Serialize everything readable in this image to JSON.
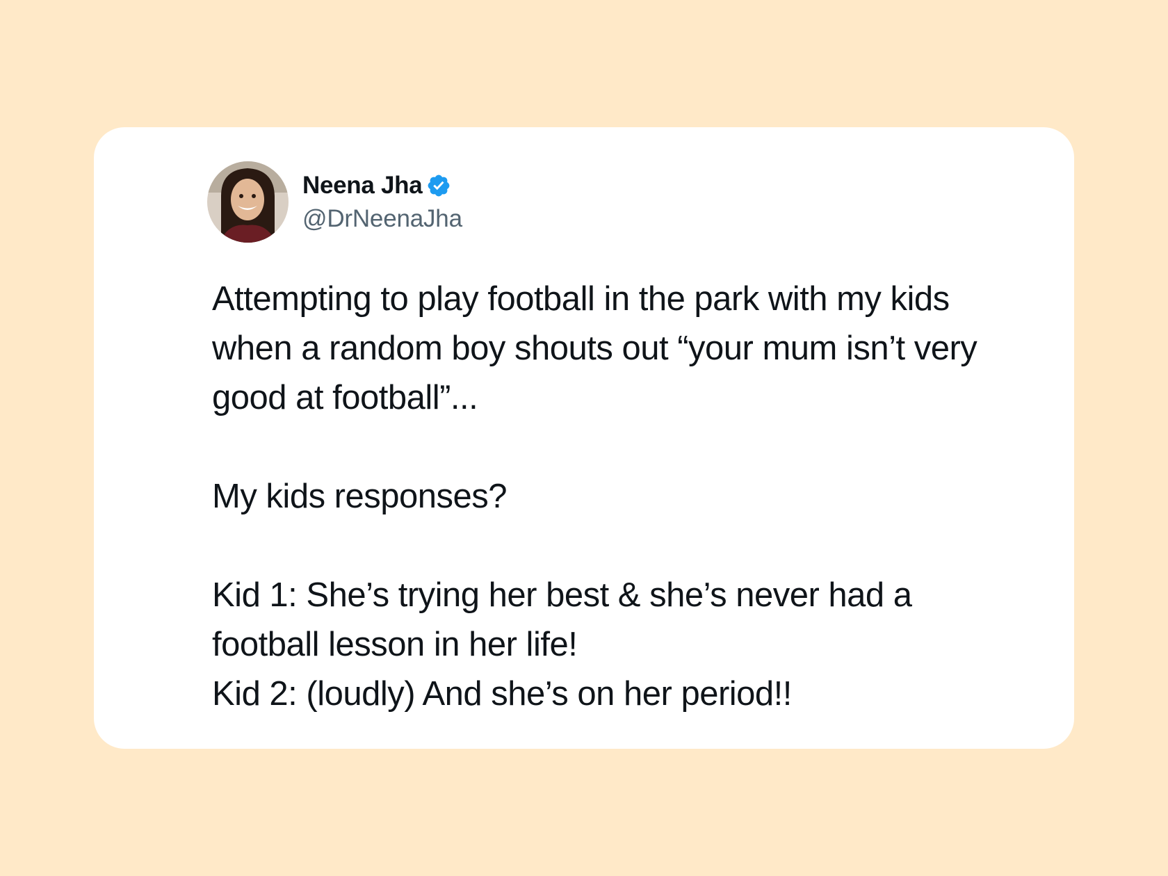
{
  "tweet": {
    "author": {
      "display_name": "Neena Jha",
      "handle": "@DrNeenaJha",
      "verified_icon": "verified-badge-icon",
      "avatar_icon": "avatar"
    },
    "paragraphs": [
      "Attempting to play football in the park with my kids when a random boy shouts out “your mum isn’t very good at football”...",
      "My kids responses?",
      "Kid 1: She’s trying her best & she’s never had a football lesson in her life!",
      "Kid 2: (loudly) And she’s on her period!!"
    ]
  },
  "colors": {
    "background": "#ffe9c8",
    "card": "#ffffff",
    "text": "#0f1419",
    "handle": "#536471",
    "verified": "#1d9bf0"
  }
}
